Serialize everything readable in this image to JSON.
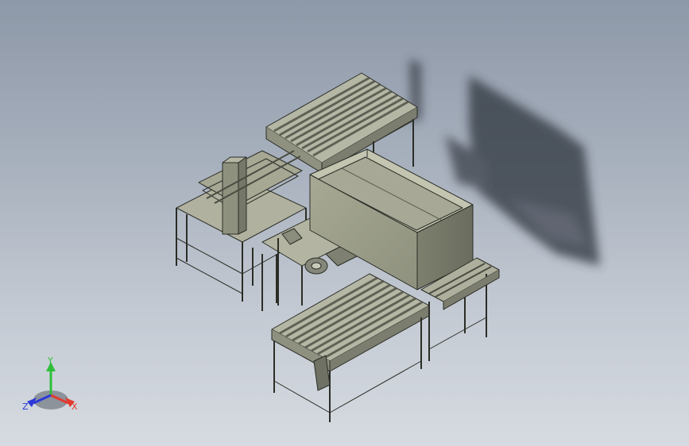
{
  "viewport": {
    "background_top": "#8d98a8",
    "background_bottom": "#d6dbe1",
    "model_color": "#9a9d8c",
    "shadow_color": "#3a3f48"
  },
  "triad": {
    "x_label": "X",
    "y_label": "Y",
    "z_label": "Z",
    "x_color": "#e23a2e",
    "y_color": "#2fbf3a",
    "z_color": "#2c39d8"
  }
}
